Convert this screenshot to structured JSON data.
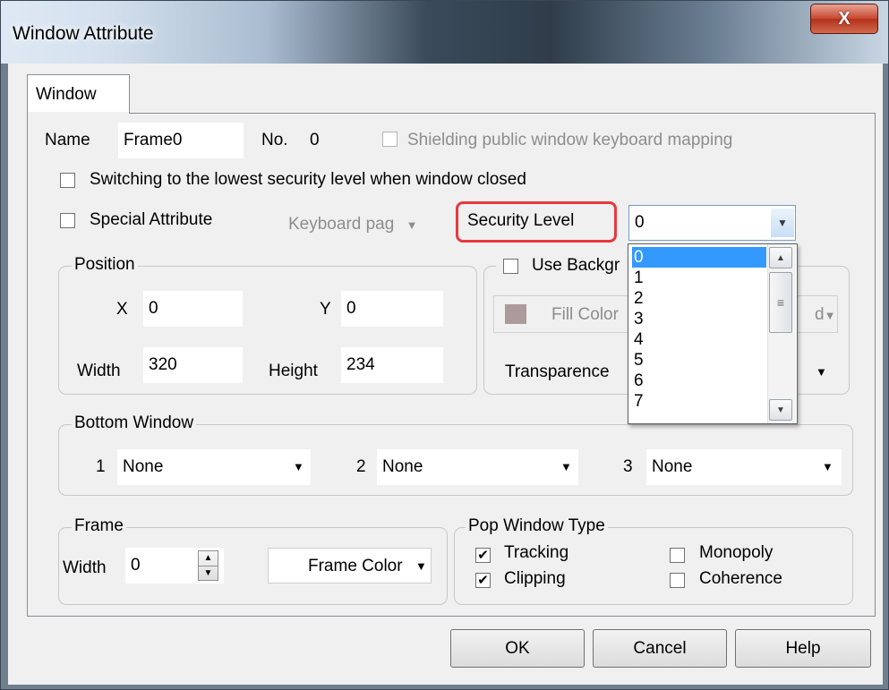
{
  "window": {
    "title": "Window Attribute",
    "close_glyph": "X"
  },
  "tabs": [
    {
      "label": "Window"
    }
  ],
  "general": {
    "name_label": "Name",
    "name_value": "Frame0",
    "no_label": "No.",
    "no_value": "0",
    "shielding_label": "Shielding public window keyboard mapping",
    "switching_label": "Switching to the lowest security level when window closed",
    "special_label": "Special Attribute",
    "keyboard_value": "Keyboard pag",
    "security_label": "Security Level",
    "security_value": "0"
  },
  "security_dropdown": {
    "options": [
      "0",
      "1",
      "2",
      "3",
      "4",
      "5",
      "6",
      "7"
    ],
    "selected_index": 0
  },
  "position": {
    "title": "Position",
    "x_label": "X",
    "x_value": "0",
    "y_label": "Y",
    "y_value": "0",
    "width_label": "Width",
    "width_value": "320",
    "height_label": "Height",
    "height_value": "234"
  },
  "background": {
    "use_label": "Use Backgr",
    "fill_label": "Fill Color",
    "fill_color": "#ad9b9c",
    "fill_right_text": "d",
    "transparence_label": "Transparence"
  },
  "bottom_window": {
    "title": "Bottom Window",
    "slots": [
      {
        "index": "1",
        "value": "None"
      },
      {
        "index": "2",
        "value": "None"
      },
      {
        "index": "3",
        "value": "None"
      }
    ]
  },
  "frame": {
    "title": "Frame",
    "width_label": "Width",
    "width_value": "0",
    "color_label": "Frame Color"
  },
  "pop_window": {
    "title": "Pop Window Type",
    "tracking_label": "Tracking",
    "tracking_checked": true,
    "clipping_label": "Clipping",
    "clipping_checked": true,
    "monopoly_label": "Monopoly",
    "monopoly_checked": false,
    "coherence_label": "Coherence",
    "coherence_checked": false
  },
  "buttons": {
    "ok": "OK",
    "cancel": "Cancel",
    "help": "Help"
  },
  "colors": {
    "highlight": "#3399ff",
    "callout": "#e8393e"
  }
}
